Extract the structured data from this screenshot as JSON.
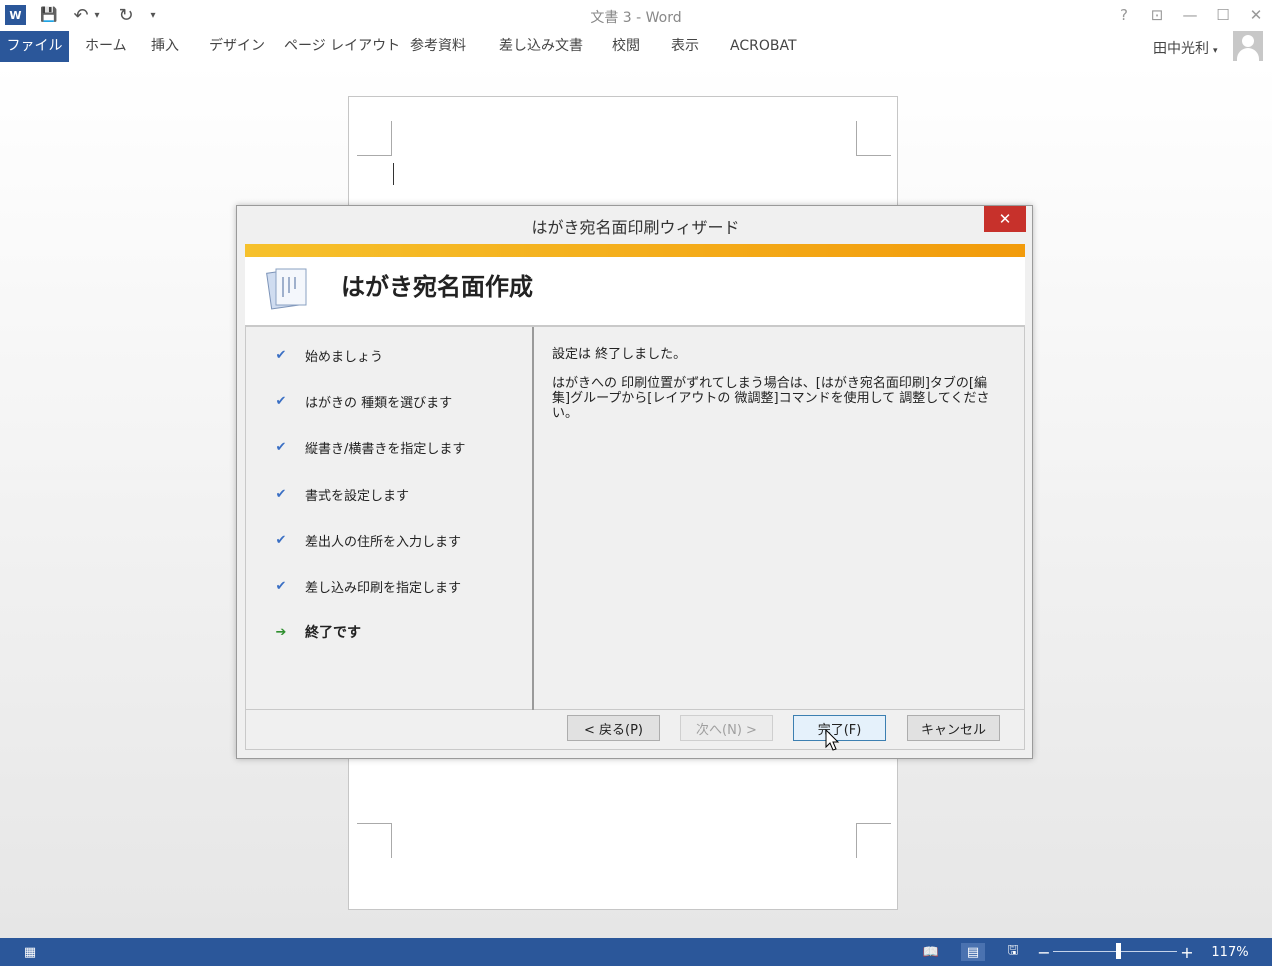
{
  "window": {
    "title": "文書 3 - Word",
    "app_icon": "word-icon",
    "app_letter": "W",
    "help": "?",
    "ribbon_display": "⊡",
    "minimize": "—",
    "maximize": "☐",
    "close": "✕"
  },
  "qat": {
    "save": "💾",
    "undo": "↶",
    "undo_drop": "▾",
    "redo": "↻",
    "customize": "▾"
  },
  "ribbon": {
    "tabs": [
      "ファイル",
      "ホーム",
      "挿入",
      "デザイン",
      "ページ レイアウト",
      "参考資料",
      "差し込み文書",
      "校閲",
      "表示",
      "ACROBAT"
    ],
    "user_name": "田中光利",
    "user_caret": "▾"
  },
  "dialog": {
    "title": "はがき宛名面印刷ウィザード",
    "close": "✕",
    "heading": "はがき宛名面作成",
    "steps": [
      {
        "label": "始めましょう",
        "mark": "✔"
      },
      {
        "label": "はがきの 種類を選びます",
        "mark": "✔"
      },
      {
        "label": "縦書き/横書きを指定します",
        "mark": "✔"
      },
      {
        "label": "書式を設定します",
        "mark": "✔"
      },
      {
        "label": "差出人の住所を入力します",
        "mark": "✔"
      },
      {
        "label": "差し込み印刷を指定します",
        "mark": "✔"
      },
      {
        "label": "終了です",
        "mark": "➔"
      }
    ],
    "message_line1": "設定は 終了しました。",
    "message_line2": "はがきへの 印刷位置がずれてしまう場合は、[はがき宛名面印刷]タブの[編集]グループから[レイアウトの 微調整]コマンドを使用して 調整してください。",
    "buttons": {
      "back": "< 戻る(P)",
      "next": "次へ(N) >",
      "finish": "完了(F)",
      "cancel": "キャンセル"
    }
  },
  "statusbar": {
    "page_icon": "▦",
    "read_mode": "📖",
    "print_layout": "▤",
    "web_layout": "🖫",
    "zoom_out": "−",
    "zoom_in": "+",
    "zoom": "117%",
    "zoom_fraction": 0.5
  },
  "colors": {
    "accent": "#2b579a",
    "dialog_close": "#c7312b",
    "orange_bar": "#f29b0b"
  }
}
